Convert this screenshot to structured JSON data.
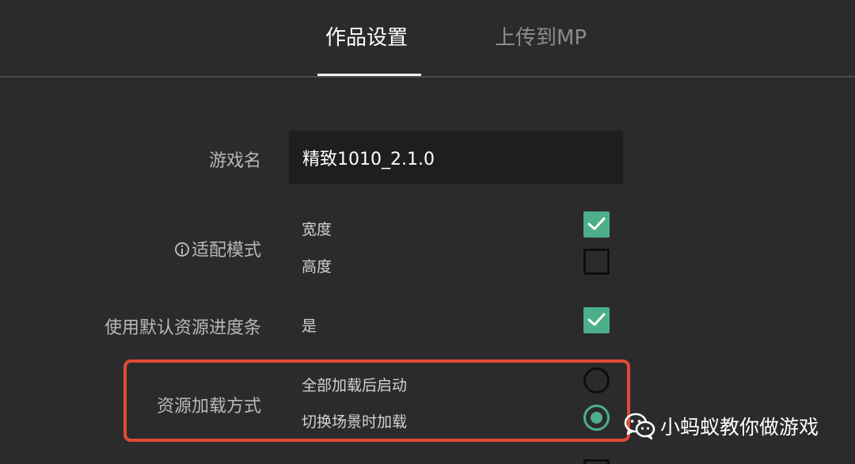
{
  "tabs": [
    {
      "label": "作品设置",
      "active": true
    },
    {
      "label": "上传到MP",
      "active": false
    }
  ],
  "game_name": {
    "label": "游戏名",
    "value": "精致1010_2.1.0"
  },
  "fit_mode": {
    "label": "适配模式",
    "options": [
      {
        "label": "宽度",
        "checked": true
      },
      {
        "label": "高度",
        "checked": false
      }
    ]
  },
  "default_progress": {
    "label": "使用默认资源进度条",
    "option": {
      "label": "是",
      "checked": true
    }
  },
  "loading_mode": {
    "label": "资源加载方式",
    "options": [
      {
        "label": "全部加载后启动",
        "selected": false
      },
      {
        "label": "切换场景时加载",
        "selected": true
      }
    ]
  },
  "watermark": {
    "text": "小蚂蚁教你做游戏",
    "icon": "wechat-icon"
  },
  "colors": {
    "accent": "#4caf8a",
    "highlight": "#e04a32",
    "background": "#2b2b2d"
  }
}
